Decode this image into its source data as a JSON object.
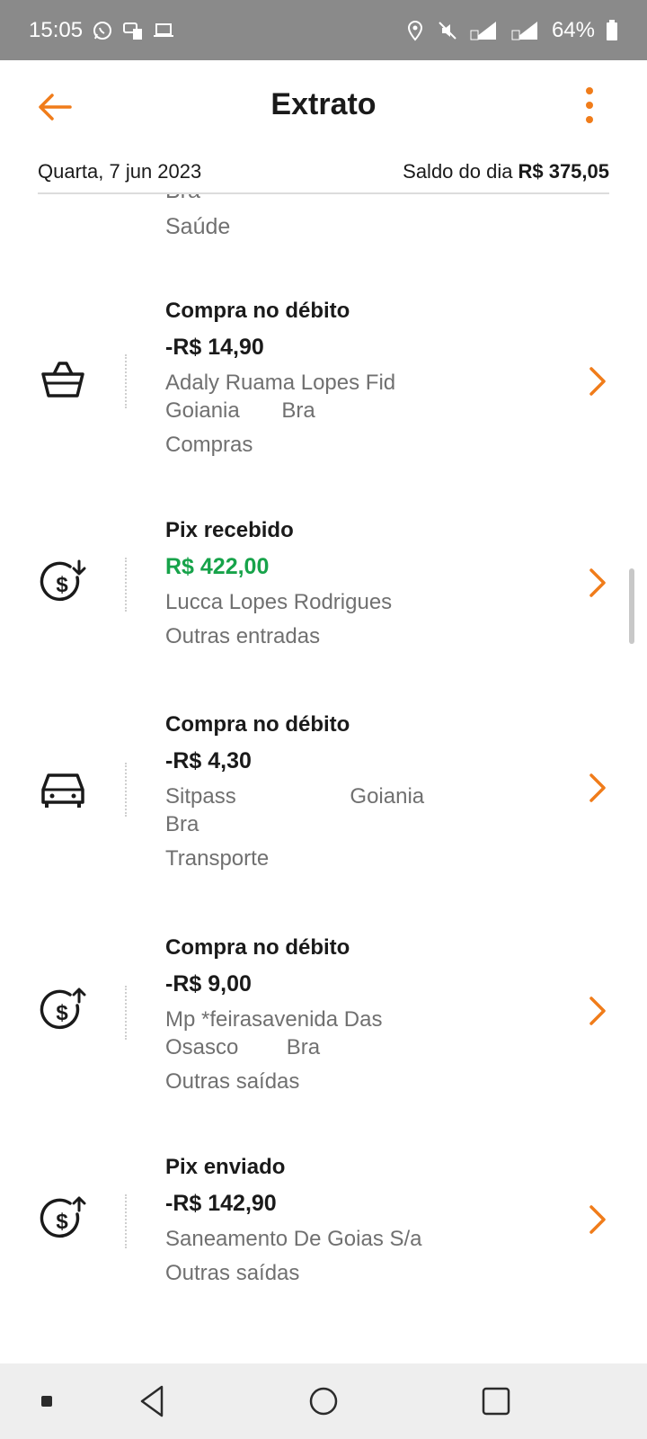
{
  "status_bar": {
    "time": "15:05",
    "left_icons": [
      "whatsapp-icon",
      "chat-sim-icon",
      "laptop-icon"
    ],
    "right_icons": [
      "location-icon",
      "mute-icon",
      "signal-4g-sim1-icon",
      "signal-4g-sim2-icon"
    ],
    "battery": "64%"
  },
  "header": {
    "title": "Extrato",
    "date": "Quarta, 7 jun 2023",
    "saldo_label": "Saldo do dia",
    "saldo_value": "R$ 375,05",
    "accent_color": "#f07c1a"
  },
  "partial_item": {
    "line1": "Bra",
    "category": "Saúde"
  },
  "transactions": [
    {
      "icon": "basket-icon",
      "type": "Compra no débito",
      "amount": "-R$ 14,90",
      "description": "Adaly Ruama Lopes Fid\nGoiania       Bra",
      "category": "Compras"
    },
    {
      "icon": "money-in-icon",
      "type": "Pix recebido",
      "amount": "R$ 422,00",
      "amount_color": "#17a34a",
      "description": "Lucca Lopes Rodrigues",
      "category": "Outras entradas"
    },
    {
      "icon": "car-icon",
      "type": "Compra no débito",
      "amount": "-R$ 4,30",
      "description": "Sitpass                   Goiania\nBra",
      "category": "Transporte"
    },
    {
      "icon": "money-out-icon",
      "type": "Compra no débito",
      "amount": "-R$ 9,00",
      "description": "Mp *feirasavenida Das\nOsasco        Bra",
      "category": "Outras saídas"
    },
    {
      "icon": "money-out-icon",
      "type": "Pix enviado",
      "amount": "-R$ 142,90",
      "description": "Saneamento De Goias S/a",
      "category": "Outras saídas"
    }
  ],
  "nav_bar": [
    "recents-dot-icon",
    "back-triangle-icon",
    "home-circle-icon",
    "overview-square-icon"
  ]
}
